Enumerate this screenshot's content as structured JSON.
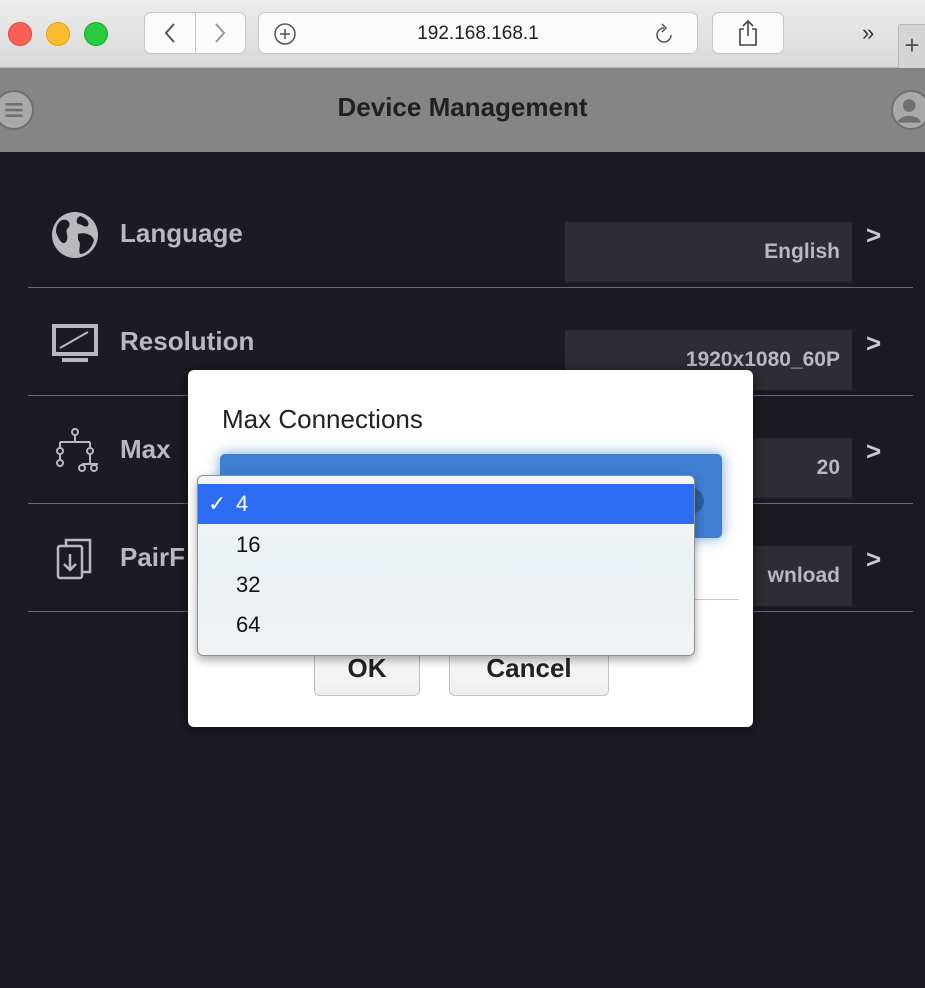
{
  "browser": {
    "url": "192.168.168.1",
    "overflow_label": "»",
    "new_tab_label": "+"
  },
  "header": {
    "title": "Device Management"
  },
  "settings": [
    {
      "label": "Language",
      "value": "English",
      "icon": "globe-icon"
    },
    {
      "label": "Resolution",
      "value": "1920x1080_60P",
      "icon": "monitor-icon"
    },
    {
      "label": "Max Connections",
      "label_visible": "Max",
      "value": "20",
      "icon": "network-tree-icon"
    },
    {
      "label": "PairPro",
      "label_visible": "PairF",
      "value": "Download",
      "value_visible": "wnload",
      "icon": "download-file-icon"
    }
  ],
  "dialog": {
    "title": "Max Connections",
    "ok_label": "OK",
    "cancel_label": "Cancel"
  },
  "dropdown": {
    "options": [
      "4",
      "16",
      "32",
      "64"
    ],
    "selected": "4",
    "check_mark": "✓"
  },
  "colors": {
    "background": "#1c1a22",
    "header": "#858585",
    "selection": "#2d6df6",
    "select_field": "#3f7fd2"
  }
}
